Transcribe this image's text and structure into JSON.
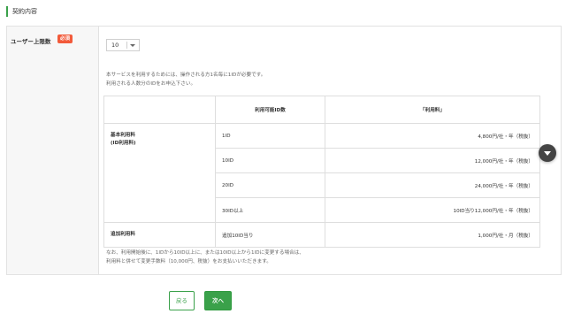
{
  "section": {
    "title": "契約内容"
  },
  "form": {
    "label": "ユーザー上限数",
    "required_badge": "必須",
    "select_value": "10",
    "description": [
      "本サービスを利用するためには、操作される方1名毎に1IDが必要です。",
      "利用される人数分のIDをお申込下さい。"
    ],
    "table": {
      "headers": [
        "",
        "利用可能ID数",
        "「利用料」"
      ],
      "basic_label": "基本利用料",
      "basic_sub": "(ID利用料)",
      "basic_rows": [
        {
          "ids": "1ID",
          "price": "4,800円/社・年（税抜）"
        },
        {
          "ids": "10ID",
          "price": "12,000円/社・年（税抜）"
        },
        {
          "ids": "20ID",
          "price": "24,000円/社・年（税抜）"
        },
        {
          "ids": "30ID以上",
          "price": "10ID当り12,000円/社・年（税抜）"
        }
      ],
      "extra_label": "追加利用料",
      "extra_row": {
        "ids": "追加10ID当り",
        "price": "1,000円/社・月（税抜）"
      }
    },
    "note": [
      "なお、利用開始後に、1IDから10ID以上に、または10ID以上から1IDに変更する場合は、",
      "利用料と併せて変更手数料（10,000円、税抜）をお支払いいただきます。"
    ]
  },
  "buttons": {
    "back": "戻る",
    "next": "次へ"
  },
  "icons": {
    "scroll": "chevron-down-icon",
    "select_arrow": "caret-down-icon"
  },
  "colors": {
    "accent": "#3aa14a",
    "required": "#f25a3a"
  }
}
